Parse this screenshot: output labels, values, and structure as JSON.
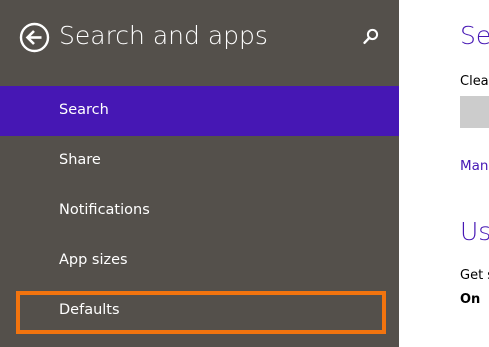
{
  "colors": {
    "pane_background": "#54504b",
    "accent": "#4617b4",
    "highlight_outline": "#f2740f",
    "content_background": "#ffffff"
  },
  "nav_pane": {
    "back_icon": "back-arrow-circle-icon",
    "title": "Search and apps",
    "search_icon": "search-icon",
    "items": [
      {
        "label": "Search",
        "selected": true
      },
      {
        "label": "Share",
        "selected": false
      },
      {
        "label": "Notifications",
        "selected": false
      },
      {
        "label": "App sizes",
        "selected": false
      },
      {
        "label": "Defaults",
        "selected": false,
        "highlighted": true
      }
    ]
  },
  "content": {
    "heading": "Sea",
    "clear_label": "Clear",
    "manage_link": "Man",
    "usage_heading": "Us",
    "setting_label": "Get s",
    "setting_value": "On"
  }
}
